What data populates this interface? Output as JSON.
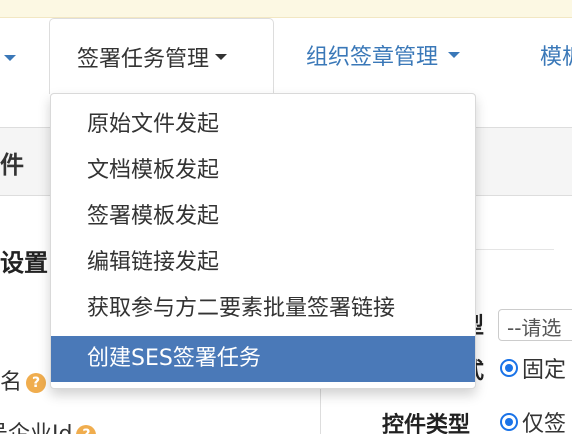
{
  "navbar": {
    "active_label": "签署任务管理",
    "org_seal_label": "组织签章管理",
    "next_label_partial": "模板"
  },
  "panel": {
    "heading_partial": "件",
    "section_title_partial": "设置"
  },
  "form": {
    "left_label_1": "名",
    "left_label_2": "号企业Id",
    "help_glyph": "?",
    "right_label_1_partial": "型",
    "right_label_2_partial": "式",
    "control_type_label": "控件类型",
    "select_value": "--请选",
    "radio_fixed": "固定",
    "radio_only": "仅签"
  },
  "dropdown": {
    "items": [
      {
        "label": "原始文件发起"
      },
      {
        "label": "文档模板发起"
      },
      {
        "label": "签署模板发起"
      },
      {
        "label": "编辑链接发起"
      },
      {
        "label": "获取参与方二要素批量签署链接"
      },
      {
        "label": "创建SES签署任务",
        "active": true
      }
    ]
  },
  "colors": {
    "link": "#3a78b8",
    "menu_active_bg": "#4a79b8",
    "help_icon": "#f0ad4e",
    "radio": "#1a73e8",
    "top_strip": "#fcf8e3"
  }
}
